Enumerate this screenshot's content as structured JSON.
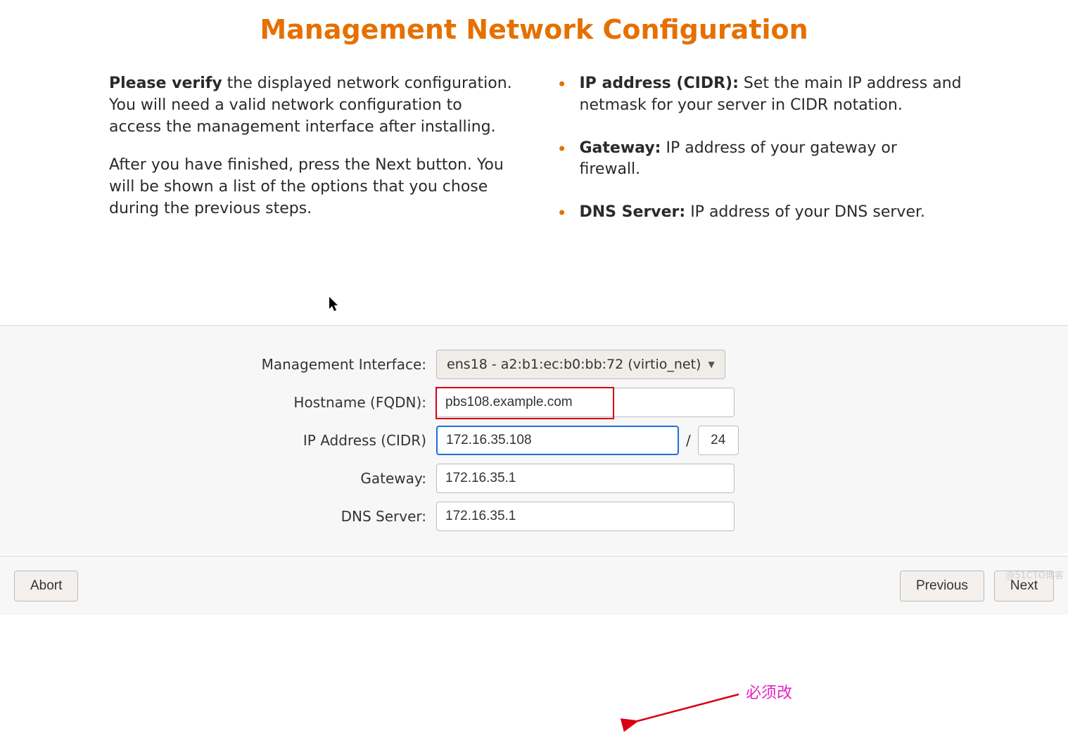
{
  "title": "Management Network Configuration",
  "info": {
    "left_p1_bold": "Please verify",
    "left_p1_rest": " the displayed network configuration. You will need a valid network configuration to access the management interface after installing.",
    "left_p2": "After you have finished, press the Next button. You will be shown a list of the options that you chose during the previous steps.",
    "bullets": [
      {
        "bold": "IP address (CIDR):",
        "rest": " Set the main IP address and netmask for your server in CIDR notation."
      },
      {
        "bold": "Gateway:",
        "rest": " IP address of your gateway or firewall."
      },
      {
        "bold": "DNS Server:",
        "rest": " IP address of your DNS server."
      }
    ]
  },
  "form": {
    "labels": {
      "iface": "Management Interface:",
      "hostname": "Hostname (FQDN):",
      "ip": "IP Address (CIDR)",
      "gateway": "Gateway:",
      "dns": "DNS Server:"
    },
    "values": {
      "iface": "ens18 - a2:b1:ec:b0:bb:72 (virtio_net)",
      "hostname": "pbs108.example.com",
      "ip": "172.16.35.108",
      "cidr": "24",
      "gateway": "172.16.35.1",
      "dns": "172.16.35.1"
    },
    "slash": "/"
  },
  "annotation": "必须改",
  "buttons": {
    "abort": "Abort",
    "previous": "Previous",
    "next": "Next"
  },
  "watermark": "@51CTO博客"
}
